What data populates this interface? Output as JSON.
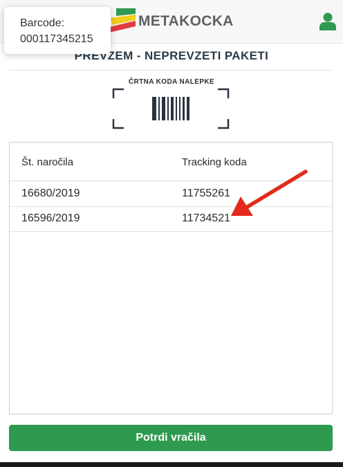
{
  "header": {
    "brand": "METAKOCKA",
    "logo_icon": "metakocka-logo-icon",
    "user_icon": "user-icon",
    "colors": {
      "brand_text": "#5f6062",
      "logo_green": "#2e9a4f",
      "logo_yellow": "#f2cd1c",
      "logo_red": "#e23b3b"
    }
  },
  "popup": {
    "label": "Barcode:",
    "value": "000117345215"
  },
  "page": {
    "title": "PREVZEM - NEPREVZETI PAKETI",
    "scan_label": "ČRTNA KODA NALEPKE",
    "scan_icon": "barcode-icon"
  },
  "table": {
    "columns": [
      "Št. naročila",
      "Tracking koda"
    ],
    "rows": [
      [
        "16680/2019",
        "11755261"
      ],
      [
        "16596/2019",
        "11734521"
      ]
    ]
  },
  "annotation": {
    "icon": "red-arrow-icon",
    "color": "#e32a1c"
  },
  "actions": {
    "confirm_label": "Potrdi vračila",
    "confirm_color": "#2e9a4f"
  }
}
